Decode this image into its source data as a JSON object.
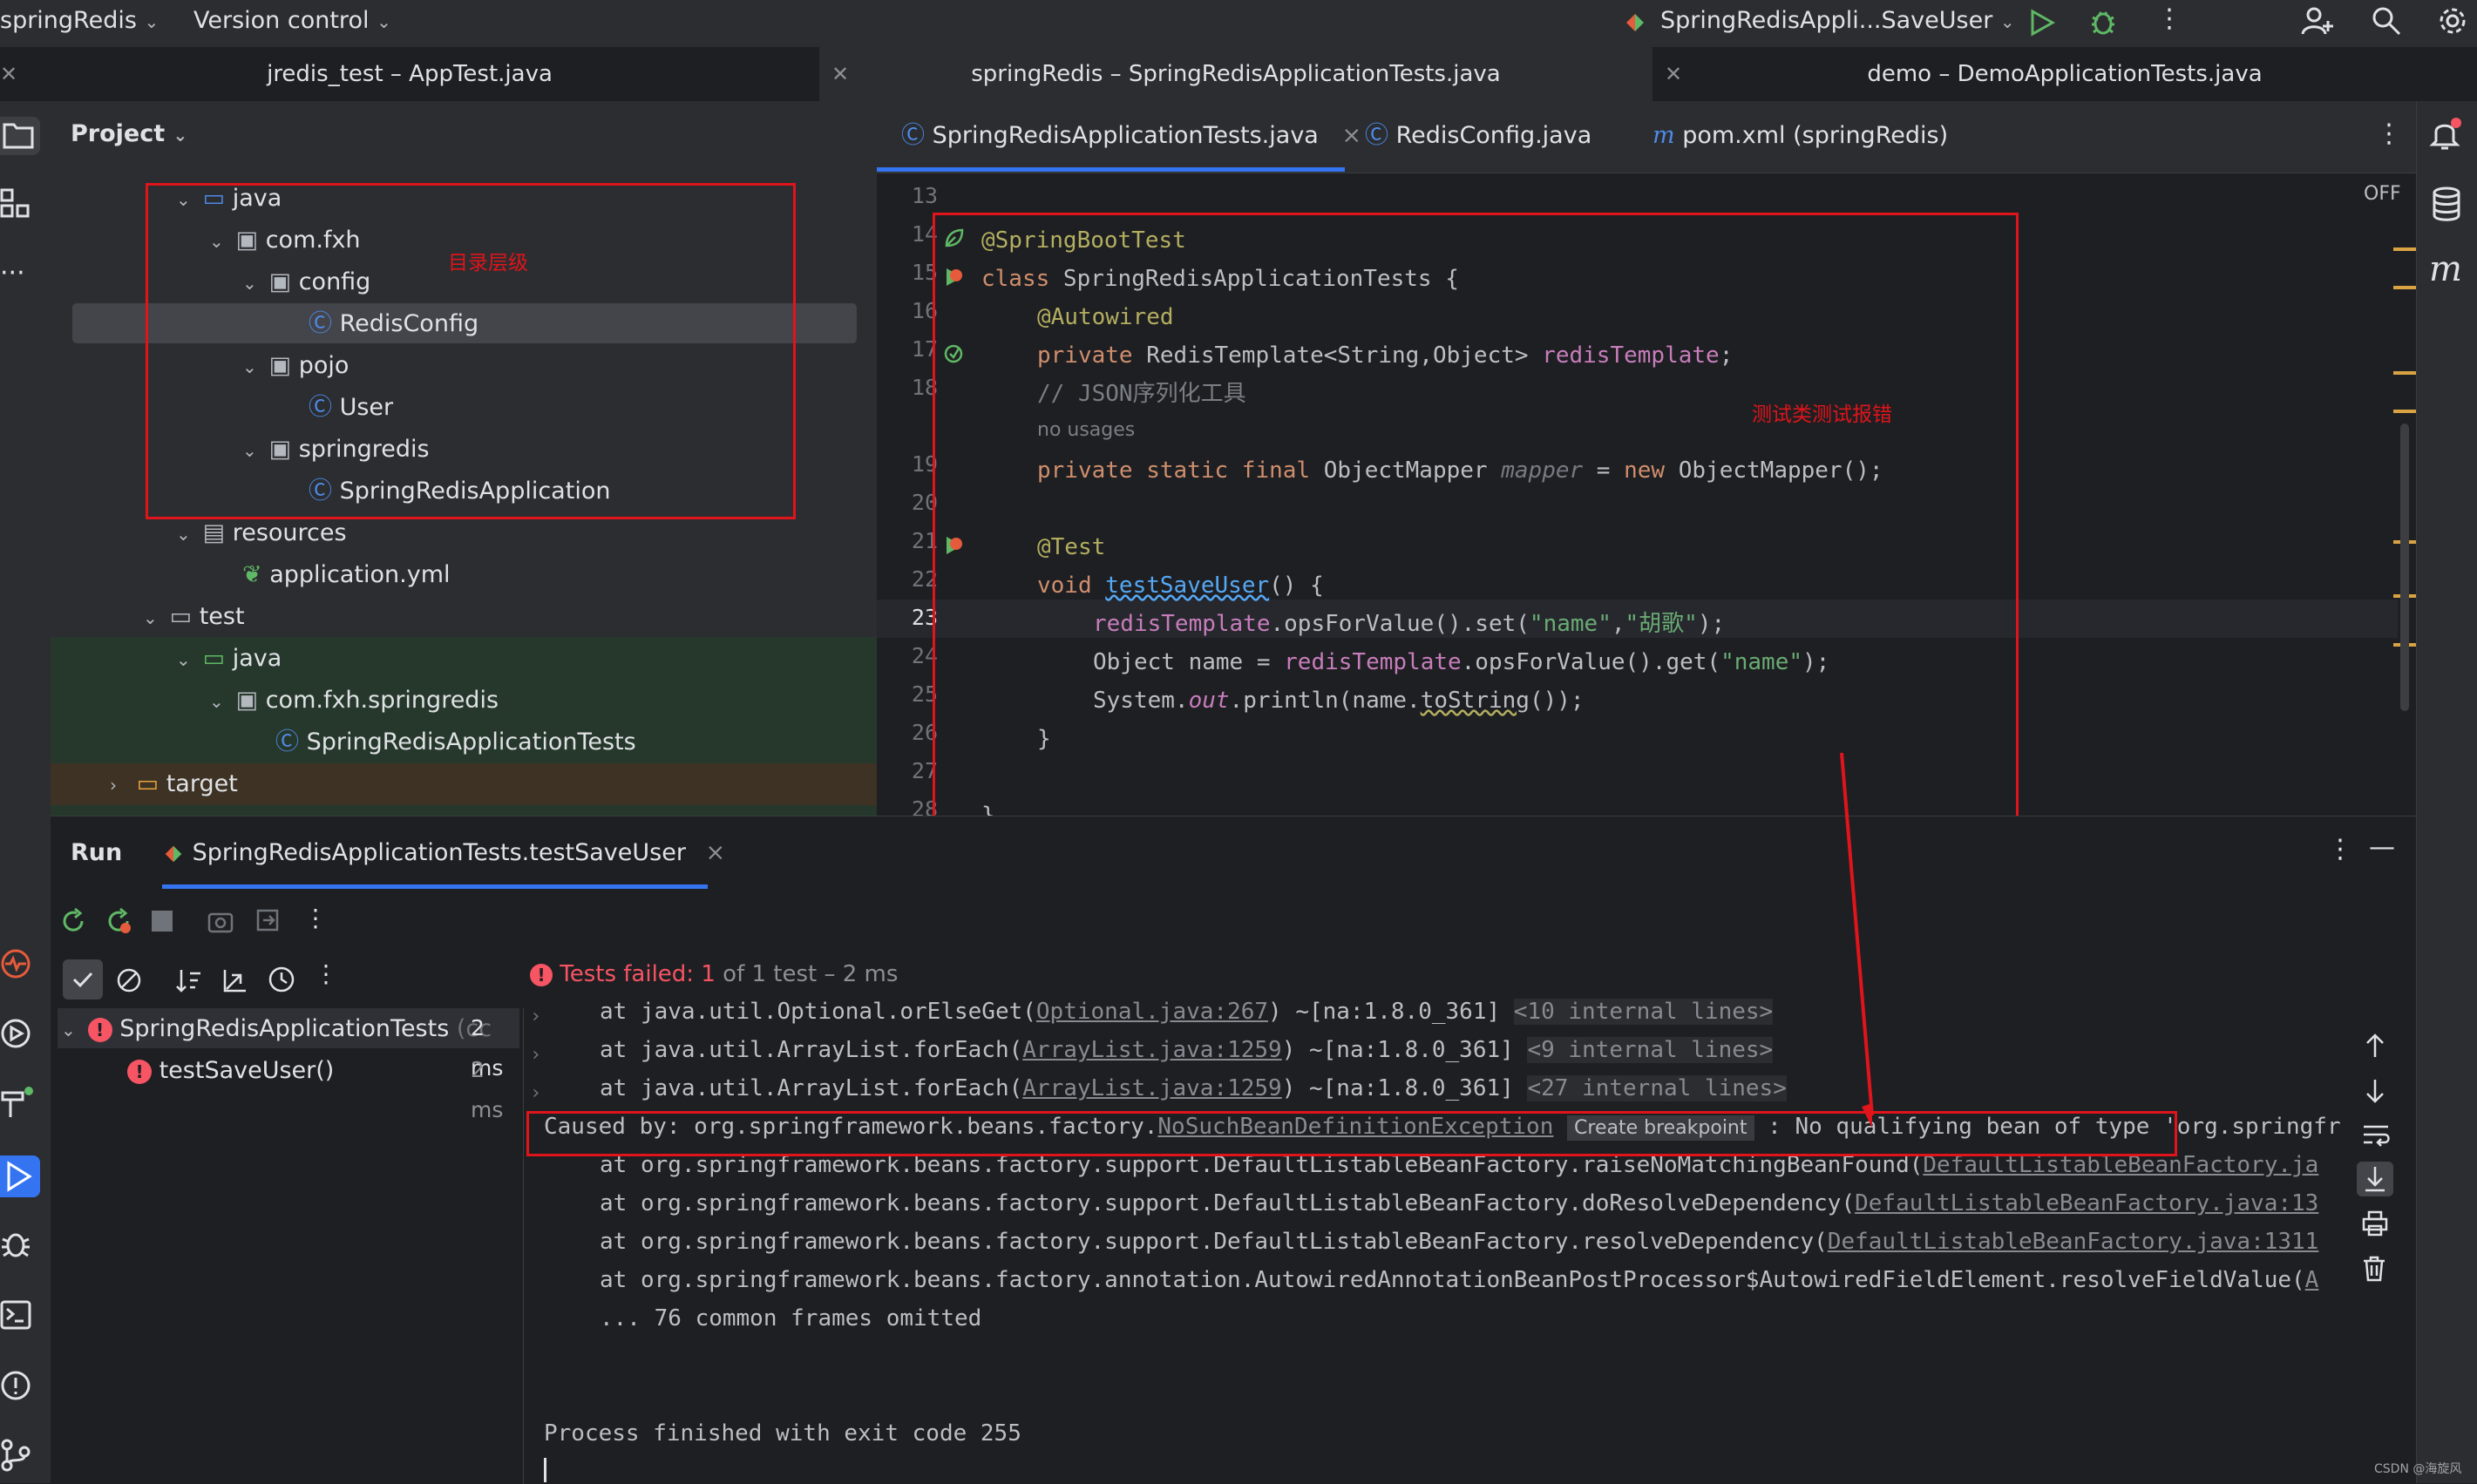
{
  "titlebar": {
    "project_name": "springRedis",
    "version_control": "Version control",
    "run_config": "SpringRedisAppli...SaveUser"
  },
  "window_tabs": [
    {
      "label": "jredis_test – AppTest.java"
    },
    {
      "label": "springRedis – SpringRedisApplicationTests.java"
    },
    {
      "label": "demo – DemoApplicationTests.java"
    }
  ],
  "project": {
    "header": "Project",
    "annotation": "目录层级",
    "tree": [
      {
        "label": "java"
      },
      {
        "label": "com.fxh"
      },
      {
        "label": "config"
      },
      {
        "label": "RedisConfig"
      },
      {
        "label": "pojo"
      },
      {
        "label": "User"
      },
      {
        "label": "springredis"
      },
      {
        "label": "SpringRedisApplication"
      },
      {
        "label": "resources"
      },
      {
        "label": "application.yml"
      },
      {
        "label": "test"
      },
      {
        "label": "java"
      },
      {
        "label": "com.fxh.springredis"
      },
      {
        "label": "SpringRedisApplicationTests"
      },
      {
        "label": "target"
      }
    ]
  },
  "editor": {
    "tabs": [
      {
        "label": "SpringRedisApplicationTests.java",
        "close": "×"
      },
      {
        "label": "RedisConfig.java"
      },
      {
        "label": "pom.xml (springRedis)"
      }
    ],
    "off_label": "OFF",
    "annotation": "测试类测试报错",
    "line_numbers": [
      "13",
      "14",
      "15",
      "16",
      "17",
      "18",
      "19",
      "20",
      "21",
      "22",
      "23",
      "24",
      "25",
      "26",
      "27",
      "28"
    ],
    "code": {
      "l14": "@SpringBootTest",
      "l15a": "class ",
      "l15b": "SpringRedisApplicationTests {",
      "l16": "@Autowired",
      "l17a": "private ",
      "l17b": "RedisTemplate<String,Object> ",
      "l17c": "redisTemplate",
      "l17d": ";",
      "l18": "// JSON序列化工具",
      "usages": "no usages",
      "l19a": "private static final ",
      "l19b": "ObjectMapper ",
      "l19c": "mapper",
      "l19d": " = ",
      "l19e": "new ",
      "l19f": "ObjectMapper();",
      "l21": "@Test",
      "l22a": "void ",
      "l22b": "testSaveUser",
      "l22c": "() {",
      "l23a": "redisTemplate",
      "l23b": ".opsForValue().set(",
      "l23c": "\"name\"",
      "l23d": ",",
      "l23e": "\"胡歌\"",
      "l23f": ");",
      "l24a": "Object name = ",
      "l24b": "redisTemplate",
      "l24c": ".opsForValue().get(",
      "l24d": "\"name\"",
      "l24e": ");",
      "l25a": "System.",
      "l25b": "out",
      "l25c": ".println(name.",
      "l25d": "toString",
      "l25e": "());",
      "l26": "}",
      "l28": "}"
    }
  },
  "run": {
    "tab_run": "Run",
    "tab_config": "SpringRedisApplicationTests.testSaveUser",
    "status_failed": "Tests failed: ",
    "status_count": "1",
    "status_rest": " of 1 test – 2 ms",
    "tests": [
      {
        "name": "SpringRedisApplicationTests",
        "extra": "(cc",
        "time": "2 ms"
      },
      {
        "name": "testSaveUser()",
        "time": "2 ms"
      }
    ],
    "console": {
      "c1a": "at java.util.Optional.orElseGet(",
      "c1b": "Optional.java:267",
      "c1c": ") ~[na:1.8.0_361] ",
      "c1d": "<10 internal lines>",
      "c2a": "at java.util.ArrayList.forEach(",
      "c2b": "ArrayList.java:1259",
      "c2c": ") ~[na:1.8.0_361] ",
      "c2d": "<9 internal lines>",
      "c3a": "at java.util.ArrayList.forEach(",
      "c3b": "ArrayList.java:1259",
      "c3c": ") ~[na:1.8.0_361] ",
      "c3d": "<27 internal lines>",
      "c4a": "Caused by: org.springframework.beans.factory.",
      "c4b": "NoSuchBeanDefinitionException",
      "c4c": "Create breakpoint",
      "c4d": " : No qualifying bean of type ",
      "c4e": "'org.springfr",
      "c5a": "at org.springframework.beans.factory.support.DefaultListableBeanFactory.raiseNoMatchingBeanFound(",
      "c5b": "DefaultListableBeanFactory.ja",
      "c6a": "at org.springframework.beans.factory.support.DefaultListableBeanFactory.doResolveDependency(",
      "c6b": "DefaultListableBeanFactory.java:13",
      "c7a": "at org.springframework.beans.factory.support.DefaultListableBeanFactory.resolveDependency(",
      "c7b": "DefaultListableBeanFactory.java:1311",
      "c8a": "at org.springframework.beans.factory.annotation.AutowiredAnnotationBeanPostProcessor$AutowiredFieldElement.resolveFieldValue(",
      "c8b": "A",
      "c9": "... 76 common frames omitted",
      "exit": "Process finished with exit code 255"
    }
  },
  "watermark": "CSDN @海旋风",
  "colors": {
    "keyword": "#cf8e6d",
    "annotation": "#b3ae60",
    "field": "#c77dbb",
    "string": "#6aab73",
    "method": "#56a8f5",
    "comment": "#7a7e85",
    "error": "#f75464",
    "red_box": "#e0141b"
  }
}
